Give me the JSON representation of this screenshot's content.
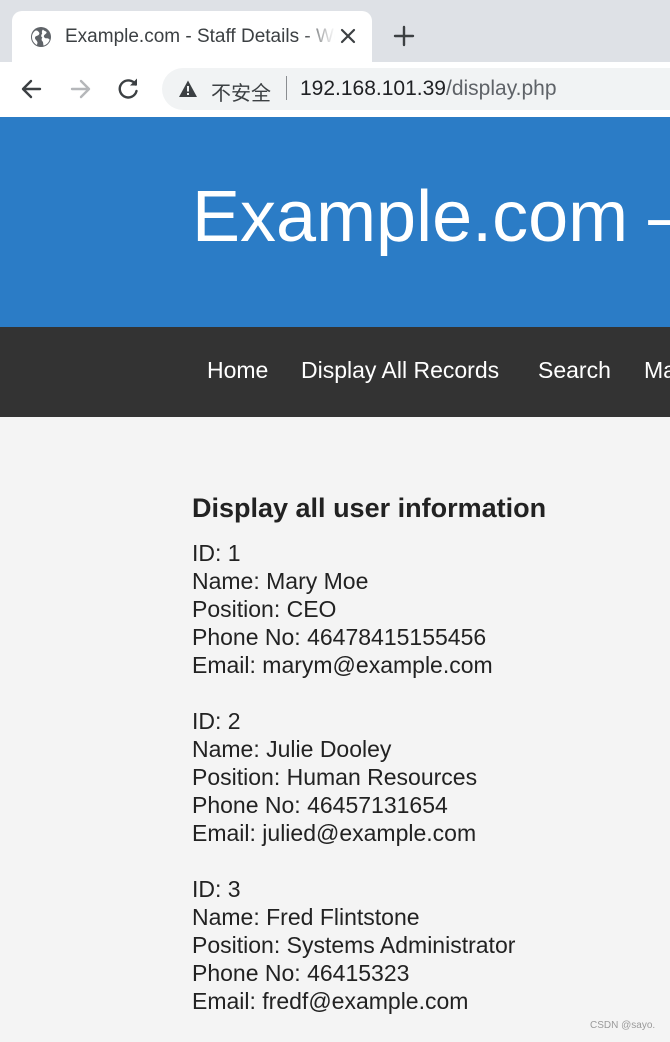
{
  "browser": {
    "tab": {
      "title": "Example.com - Staff Details - Web",
      "favicon": "globe-icon"
    },
    "security_label": "不安全",
    "url": {
      "host": "192.168.101.39",
      "path": "/display.php"
    }
  },
  "site": {
    "title": "Example.com – Staff Details",
    "nav": [
      "Home",
      "Display All Records",
      "Search",
      "Manage"
    ]
  },
  "content": {
    "heading": "Display all user information",
    "records": [
      {
        "id": "ID: 1",
        "name": "Name: Mary Moe",
        "position": "Position: CEO",
        "phone": "Phone No: 46478415155456",
        "email": "Email: marym@example.com"
      },
      {
        "id": "ID: 2",
        "name": "Name: Julie Dooley",
        "position": "Position: Human Resources",
        "phone": "Phone No: 46457131654",
        "email": "Email: julied@example.com"
      },
      {
        "id": "ID: 3",
        "name": "Name: Fred Flintstone",
        "position": "Position: Systems Administrator",
        "phone": "Phone No: 46415323",
        "email": "Email: fredf@example.com"
      }
    ]
  },
  "watermark": "CSDN @sayo.",
  "colors": {
    "header_bg": "#2b7cc6",
    "nav_bg": "#333333",
    "page_bg": "#f4f4f4"
  }
}
